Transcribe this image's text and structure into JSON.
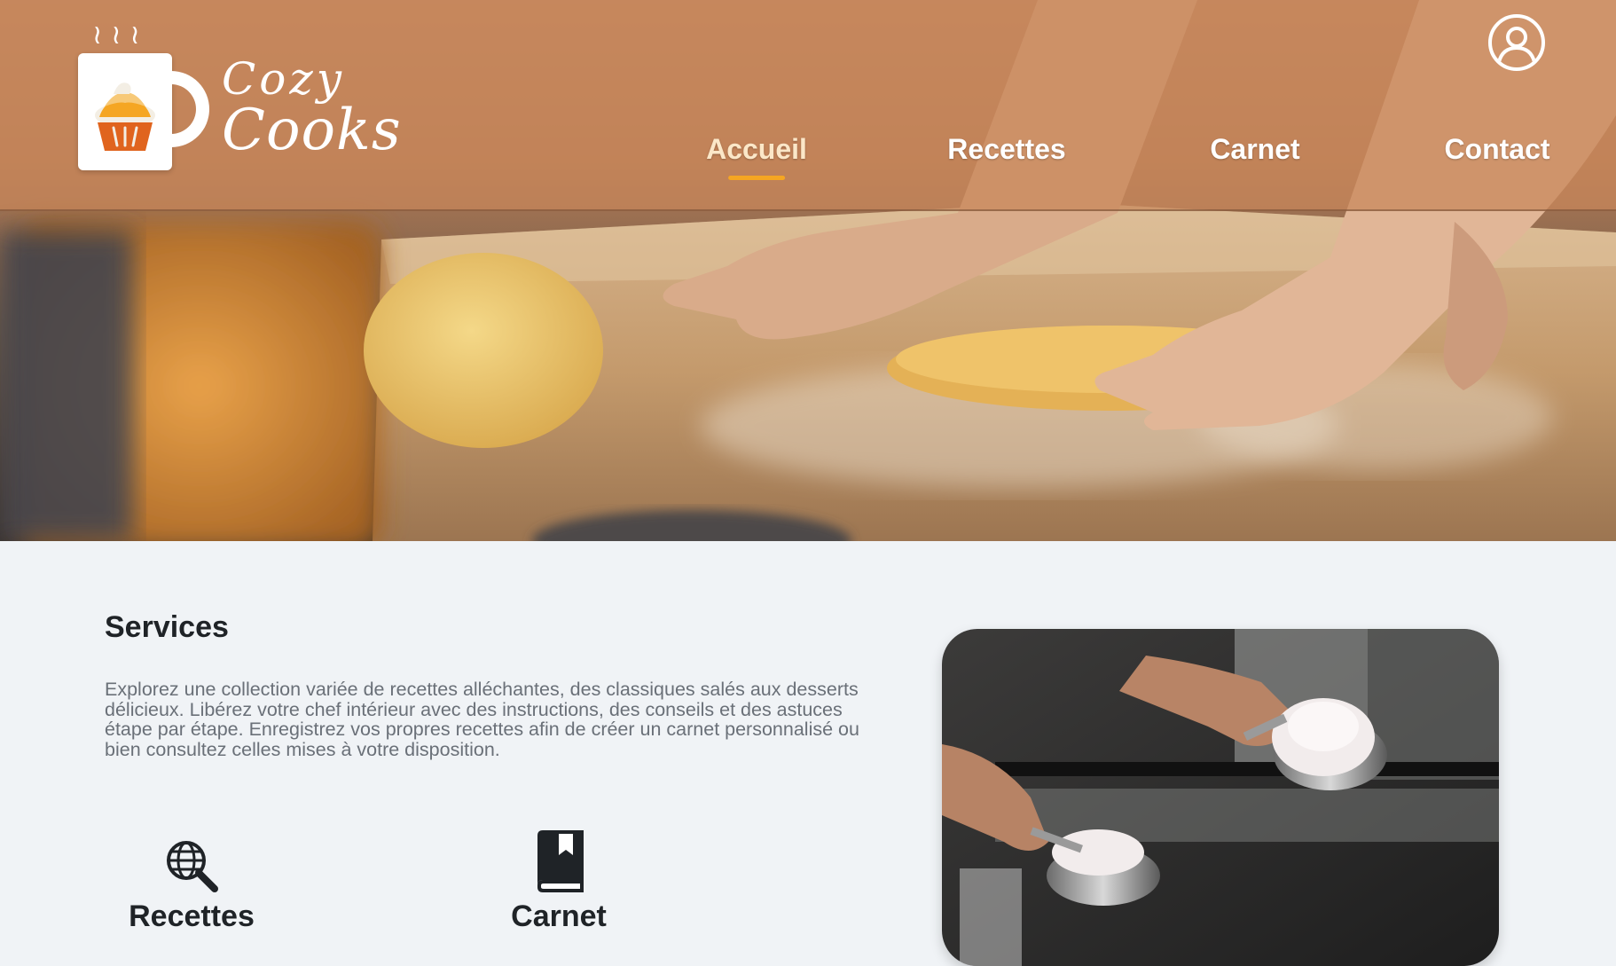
{
  "brand": {
    "name_line1": "Cozy",
    "name_line2": "Cooks",
    "steam": "≀≀≀"
  },
  "header": {
    "profile_icon": "user-circle-icon"
  },
  "nav": {
    "items": [
      {
        "label": "Accueil",
        "active": true
      },
      {
        "label": "Recettes",
        "active": false
      },
      {
        "label": "Carnet",
        "active": false
      },
      {
        "label": "Contact",
        "active": false
      }
    ]
  },
  "services": {
    "title": "Services",
    "description": "Explorez une collection variée de recettes alléchantes, des classiques salés aux desserts délicieux. Libérez votre chef intérieur avec des instructions, des conseils et des astuces étape par étape. Enregistrez vos propres recettes afin de créer un carnet personnalisé ou bien consultez celles mises à votre disposition.",
    "cards": [
      {
        "label": "Recettes",
        "icon": "globe-search-icon"
      },
      {
        "label": "Carnet",
        "icon": "book-icon"
      }
    ]
  },
  "colors": {
    "accent": "#f5a623",
    "header_band": "#c8875a",
    "page_background": "#f0f3f6",
    "heading_text": "#1f2327",
    "body_text": "#6a7078"
  }
}
